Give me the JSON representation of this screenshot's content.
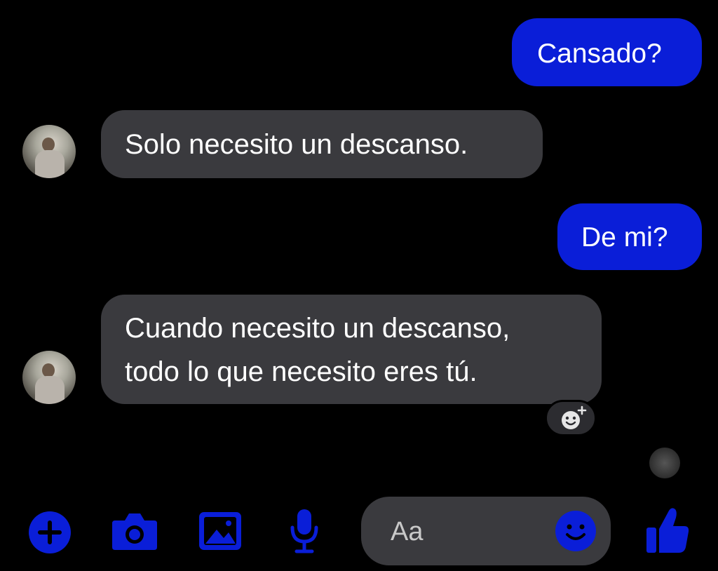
{
  "messages": [
    {
      "id": "m1",
      "direction": "sent",
      "lines": [
        "Cansado?"
      ]
    },
    {
      "id": "m2",
      "direction": "received",
      "lines": [
        "Solo necesito un descanso."
      ]
    },
    {
      "id": "m3",
      "direction": "sent",
      "lines": [
        "De mi?"
      ]
    },
    {
      "id": "m4",
      "direction": "received",
      "lines": [
        "Cuando necesito un descanso,",
        "todo lo que necesito eres tú."
      ]
    }
  ],
  "composer": {
    "placeholder": "Aa"
  },
  "toolbar": {
    "icons": [
      "plus-icon",
      "camera-icon",
      "gallery-icon",
      "microphone-icon",
      "emoji-icon",
      "thumbs-up-icon"
    ]
  },
  "colors": {
    "background": "#000000",
    "sent_bubble": "#0a1ed8",
    "received_bubble": "#3a3a3e",
    "accent": "#0a1ed8"
  }
}
